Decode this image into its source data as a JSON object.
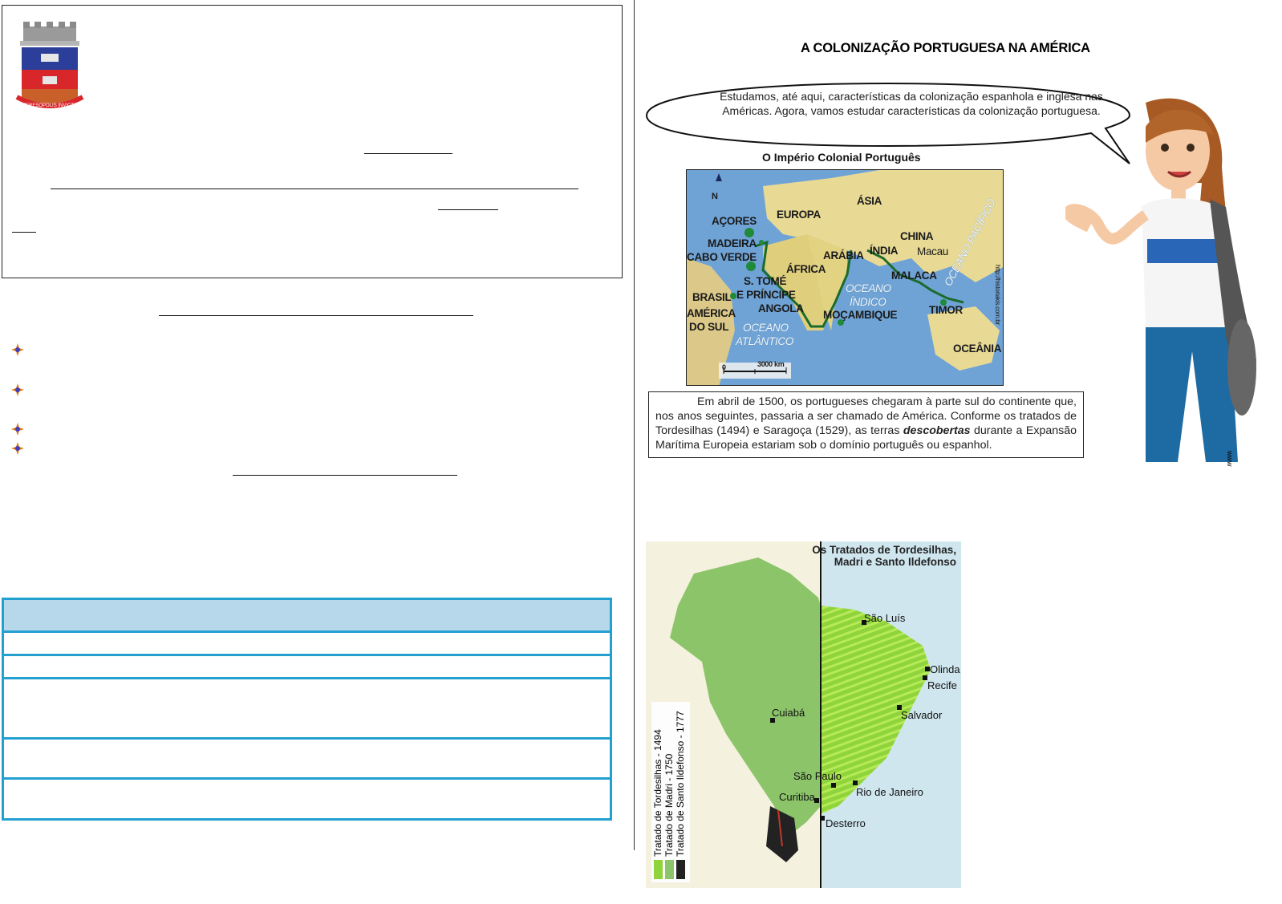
{
  "crest": {
    "motto": "TERESOPOLIS INVICTA"
  },
  "right_page": {
    "title": "A COLONIZAÇÃO PORTUGUESA NA AMÉRICA",
    "speech_bubble": "Estudamos, até aqui, características da colonização espanhola e inglesa nas Américas. Agora, vamos estudar características da colonização portuguesa.",
    "world_map": {
      "title": "O Império Colonial Português",
      "north": "N",
      "scale": [
        "0",
        "3000 km"
      ],
      "credit": "http://historiakis.com.br",
      "labels": {
        "acores": "AÇORES",
        "europa": "EUROPA",
        "asia": "ÁSIA",
        "madeira": "MADEIRA",
        "cabo_verde": "CABO VERDE",
        "china": "CHINA",
        "macau": "Macau",
        "arabia": "ARÁBIA",
        "india": "ÍNDIA",
        "africa": "ÁFRICA",
        "malaca": "MALACA",
        "sao_tome": "S. TOMÉ",
        "principe": "E PRÍNCIPE",
        "brasil": "BRASIL",
        "america": "AMÉRICA",
        "do_sul": "DO SUL",
        "angola": "ANGOLA",
        "mocambique": "MOÇAMBIQUE",
        "timor": "TIMOR",
        "oceania": "OCEÂNIA",
        "oceano_indico_1": "OCEANO",
        "oceano_indico_2": "ÍNDICO",
        "oceano_atlantico_1": "OCEANO",
        "oceano_atlantico_2": "ATLÂNTICO",
        "oceano_pacifico": "OCEANO PACÍFICO"
      }
    },
    "text_box": {
      "before": "Em abril de 1500, os portugueses chegaram à parte sul do continente que, nos anos seguintes, passaria a ser chamado de América. Conforme os tratados de Tordesilhas (1494) e Saragoça (1529), as terras ",
      "emphasis": "descobertas",
      "after": " durante a Expansão Marítima Europeia estariam sob o domínio português ou espanhol."
    },
    "brazil_map": {
      "title_line1": "Os Tratados de Tordesilhas,",
      "title_line2": "Madri e Santo Ildefonso",
      "cities": {
        "sao_luis": "São Luís",
        "olinda": "Olinda",
        "recife": "Recife",
        "salvador": "Salvador",
        "cuiaba": "Cuiabá",
        "sao_paulo": "São Paulo",
        "rio": "Rio de Janeiro",
        "curitiba": "Curitiba",
        "desterro": "Desterro"
      },
      "legend": [
        "Tratado de Tordesilhas - 1494",
        "Tratado de Madri - 1750",
        "Tratado de Santo Ildefonso - 1777"
      ],
      "colors": {
        "tordesilhas": "#8fd43a",
        "madri": "#8cc46a",
        "ildefonso": "#222222",
        "sea": "#cfe6ee",
        "land": "#f4f1de"
      }
    },
    "side_mark": "www"
  }
}
